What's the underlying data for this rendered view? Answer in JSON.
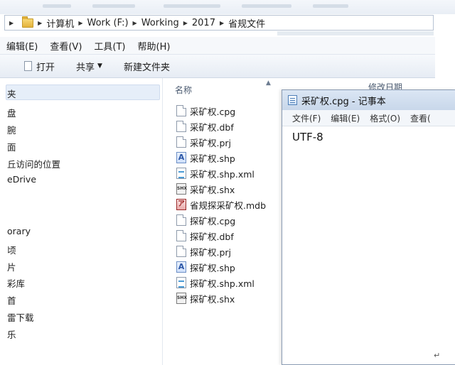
{
  "address": {
    "crumbs": [
      "计算机",
      "Work (F:)",
      "Working",
      "2017",
      "省规文件"
    ]
  },
  "menu": {
    "items": [
      "编辑(E)",
      "查看(V)",
      "工具(T)",
      "帮助(H)"
    ]
  },
  "toolbar": {
    "open_label": "打开",
    "share_label": "共享",
    "new_folder_label": "新建文件夹"
  },
  "nav": {
    "items": [
      "夹",
      "盘",
      "腕",
      "面",
      "丘访问的位置",
      "eDrive",
      "orary",
      "顷",
      "片",
      "彩库",
      "首",
      "雷下载",
      "乐"
    ]
  },
  "file_list": {
    "name_header": "名称",
    "date_header": "修改日期",
    "files": [
      {
        "name": "采矿权.cpg",
        "icon": "blank-file-icon"
      },
      {
        "name": "采矿权.dbf",
        "icon": "blank-file-icon"
      },
      {
        "name": "采矿权.prj",
        "icon": "blank-file-icon"
      },
      {
        "name": "采矿权.shp",
        "icon": "shp-file-icon"
      },
      {
        "name": "采矿权.shp.xml",
        "icon": "xml-file-icon"
      },
      {
        "name": "采矿权.shx",
        "icon": "shx-file-icon"
      },
      {
        "name": "省规探采矿权.mdb",
        "icon": "mdb-file-icon"
      },
      {
        "name": "探矿权.cpg",
        "icon": "blank-file-icon"
      },
      {
        "name": "探矿权.dbf",
        "icon": "blank-file-icon"
      },
      {
        "name": "探矿权.prj",
        "icon": "blank-file-icon"
      },
      {
        "name": "探矿权.shp",
        "icon": "shp-file-icon"
      },
      {
        "name": "探矿权.shp.xml",
        "icon": "xml-file-icon"
      },
      {
        "name": "探矿权.shx",
        "icon": "shx-file-icon"
      }
    ]
  },
  "notepad": {
    "title": "采矿权.cpg - 记事本",
    "menu": [
      "文件(F)",
      "编辑(E)",
      "格式(O)",
      "查看("
    ],
    "content": "UTF-8"
  },
  "colors": {
    "selection": "#e6eef9",
    "titlebar": "#c8d7ea",
    "border": "#8a9bb3"
  }
}
